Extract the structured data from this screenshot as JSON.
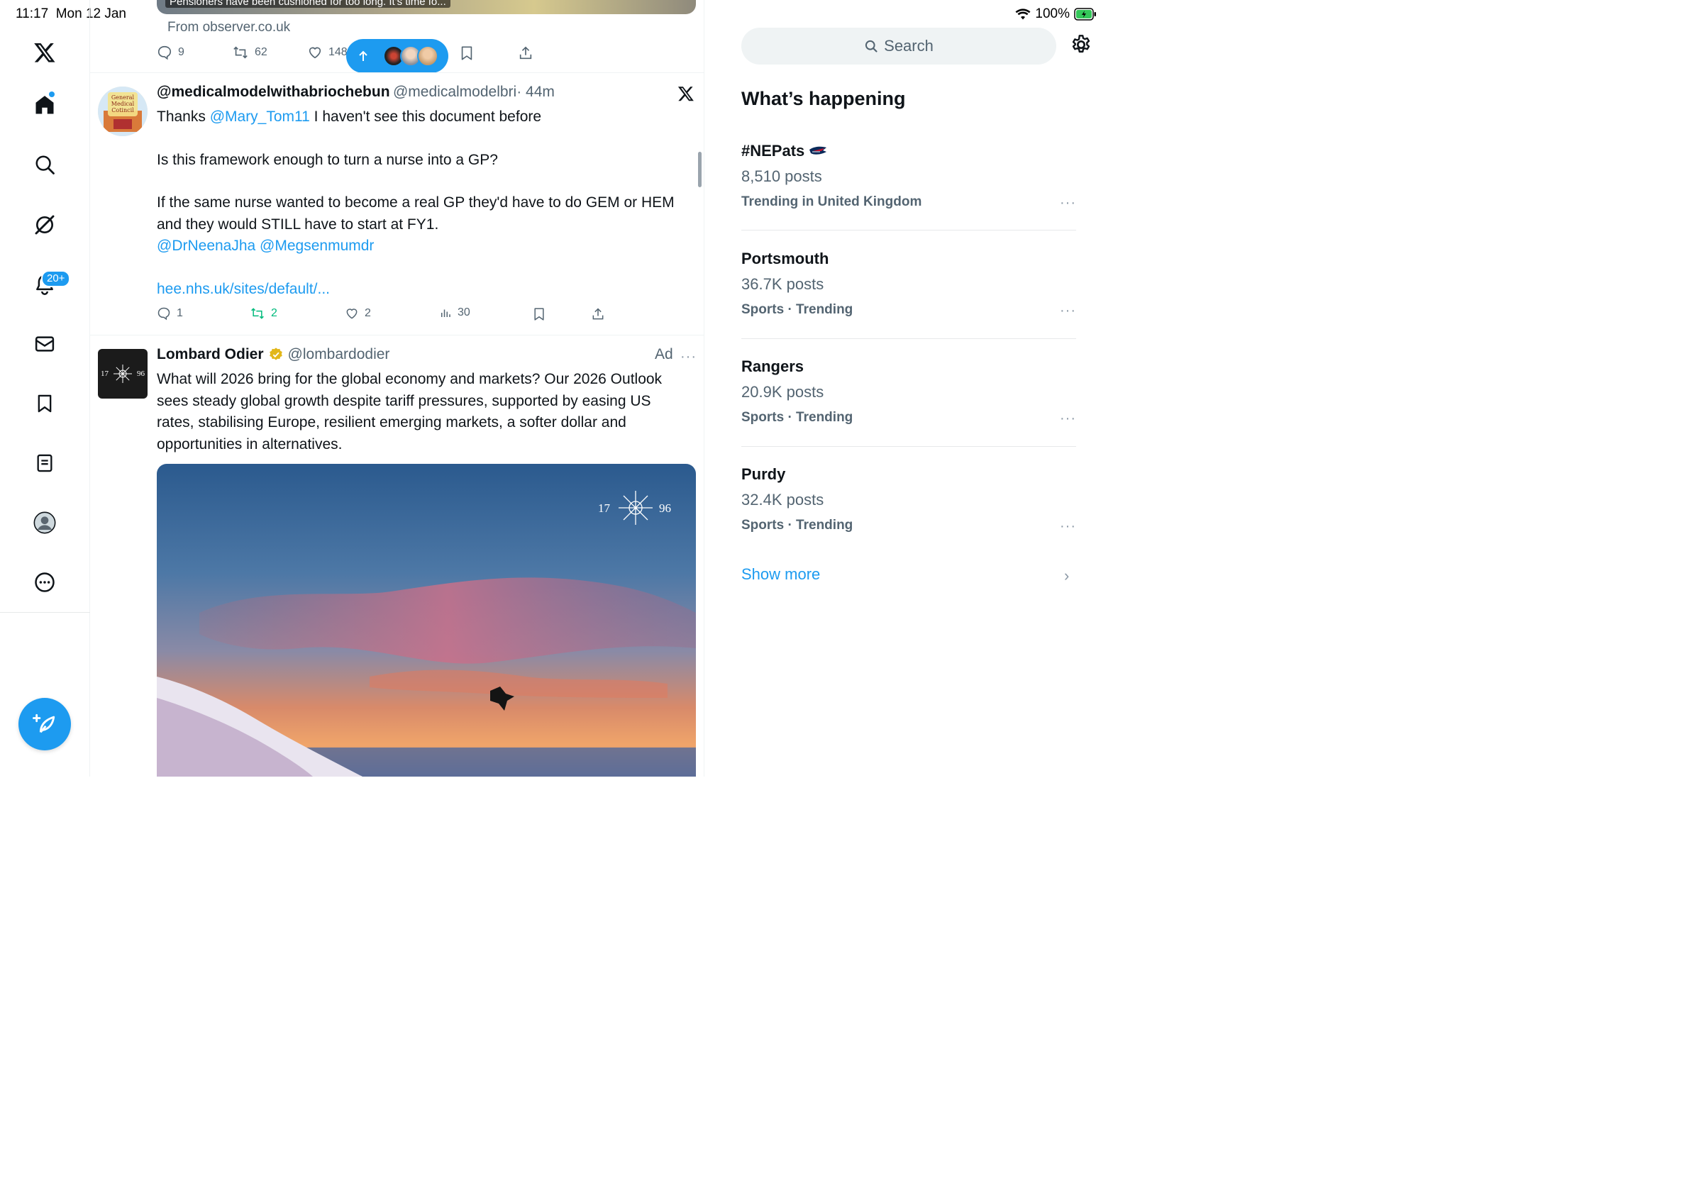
{
  "status_bar": {
    "time": "11:17",
    "date": "Mon 12 Jan",
    "battery": "100%"
  },
  "nav": {
    "notifications_badge": "20+"
  },
  "top_tweet": {
    "image_caption": "Pensioners have been cushioned for too long. It's time fo...",
    "source": "From observer.co.uk",
    "replies": "9",
    "retweets": "62",
    "likes": "148"
  },
  "tweet1": {
    "name": "@medicalmodelwithabriochebun",
    "handle": "@medicalmodelbri",
    "time": "· 44m",
    "avatar_text": "General Medical Cotincil",
    "line1_prefix": "Thanks ",
    "mention1": "@Mary_Tom11",
    "line1_suffix": " I haven't see this document before",
    "para2": "Is this framework enough to turn a nurse into a GP?",
    "para3": "If the same nurse wanted to become a real GP they'd have to do GEM or HEM and they would STILL have to start at FY1.",
    "mentions2": "@DrNeenaJha @Megsenmumdr",
    "link": "hee.nhs.uk/sites/default/...",
    "replies": "1",
    "retweets": "2",
    "likes": "2",
    "views": "30"
  },
  "ad_tweet": {
    "name": "Lombard Odier",
    "handle": "@lombardodier",
    "ad_label": "Ad",
    "text": "What will 2026 bring for the global economy and markets? Our 2026 Outlook sees steady global growth despite tariff pressures, supported by easing US rates, stabilising Europe, resilient emerging markets, a softer dollar and opportunities in alternatives.",
    "logo_left": "17",
    "logo_right": "96"
  },
  "right": {
    "search_placeholder": "Search",
    "heading": "What’s happening",
    "trends": [
      {
        "title": "#NEPats",
        "count": "8,510 posts",
        "context": "Trending in United Kingdom"
      },
      {
        "title": "Portsmouth",
        "count": "36.7K posts",
        "context": "Sports · Trending"
      },
      {
        "title": "Rangers",
        "count": "20.9K posts",
        "context": "Sports · Trending"
      },
      {
        "title": "Purdy",
        "count": "32.4K posts",
        "context": "Sports · Trending"
      }
    ],
    "show_more": "Show more"
  },
  "colors": {
    "accent": "#1d9bf0",
    "retweet_green": "#00ba7c",
    "text_primary": "#0f1419",
    "text_secondary": "#536471"
  }
}
